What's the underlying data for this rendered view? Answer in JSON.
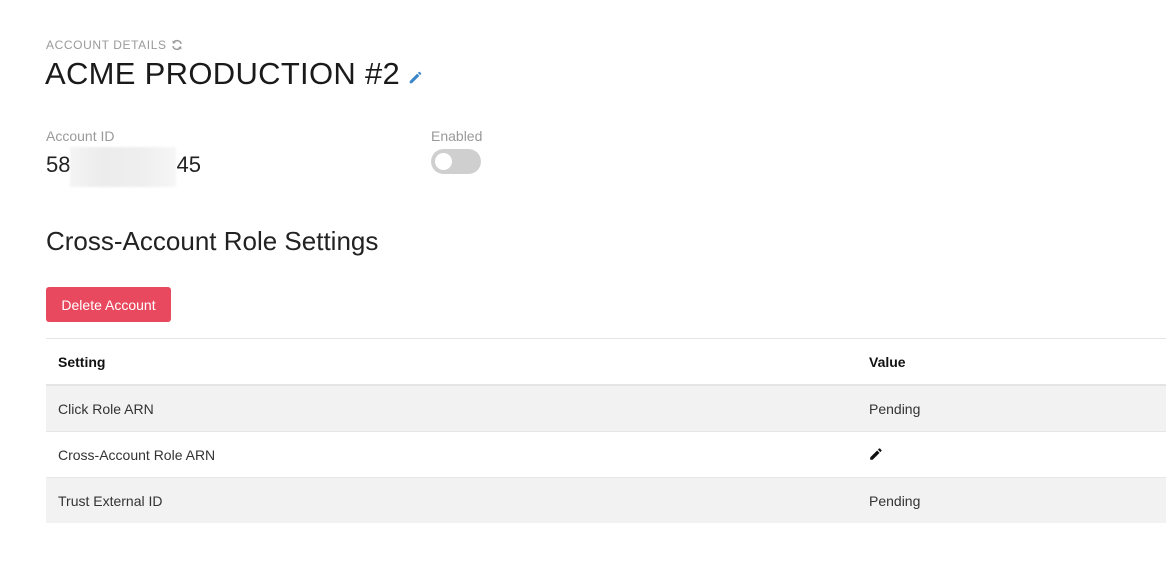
{
  "header": {
    "eyebrow": "ACCOUNT DETAILS",
    "title": "ACME PRODUCTION #2",
    "refresh_icon": "refresh-icon",
    "edit_icon": "pencil-icon"
  },
  "account": {
    "id_label": "Account ID",
    "id_prefix": "58",
    "id_suffix": "45",
    "enabled_label": "Enabled",
    "enabled": false
  },
  "section": {
    "title": "Cross-Account Role Settings",
    "delete_label": "Delete Account"
  },
  "table": {
    "headers": [
      "Setting",
      "Value"
    ],
    "rows": [
      {
        "setting": "Click Role ARN",
        "value": "Pending"
      },
      {
        "setting": "Cross-Account Role ARN",
        "value": "",
        "value_icon": "pencil-icon"
      },
      {
        "setting": "Trust External ID",
        "value": "Pending"
      }
    ]
  },
  "colors": {
    "danger": "#e8495e",
    "accent": "#3a86c8",
    "toggle_off": "#cfcfcf",
    "row_shade": "#f2f2f2"
  }
}
